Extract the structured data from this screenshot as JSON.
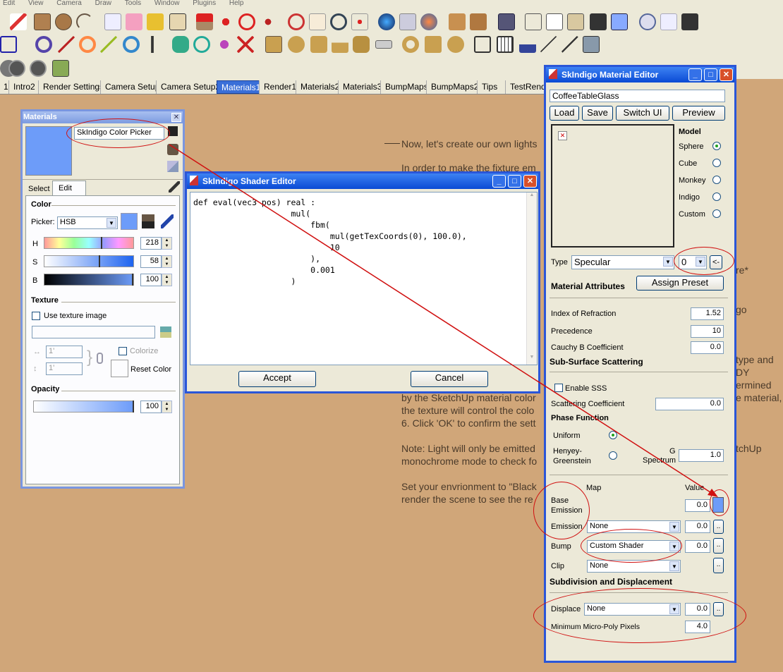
{
  "menubar": [
    "Edit",
    "View",
    "Camera",
    "Draw",
    "Tools",
    "Window",
    "Plugins",
    "Help"
  ],
  "tabs": [
    {
      "label": "1"
    },
    {
      "label": "Intro2"
    },
    {
      "label": "Render Settings"
    },
    {
      "label": "Camera Setup"
    },
    {
      "label": "Camera Setup2"
    },
    {
      "label": "Materials1",
      "active": true
    },
    {
      "label": "Render1"
    },
    {
      "label": "Materials2"
    },
    {
      "label": "Materials3"
    },
    {
      "label": "BumpMaps"
    },
    {
      "label": "BumpMaps2"
    },
    {
      "label": "Tips"
    },
    {
      "label": "TestRend"
    }
  ],
  "background_text": {
    "line1": "Now, let's create our own lights",
    "line2": "In order to make the fixture em",
    "line3": "re*",
    "line4": "go",
    "line5": "type and",
    "line6": "DY",
    "line7": "ermined",
    "line8": "by the SketchUp material color",
    "line9": "e material,",
    "line10": "the texture will control the colo",
    "line11": "6. Click 'OK' to confirm the sett",
    "line12": "Note: Light will only be emitted",
    "line13": "tchUp",
    "line14": "monochrome mode to check fo",
    "line15": "Set your envrionment to \"Black",
    "line16": "render the scene to see the re"
  },
  "materials": {
    "title": "Materials",
    "name_value": "SkIndigo Color Picker",
    "tab_select": "Select",
    "tab_edit": "Edit",
    "color_heading": "Color",
    "picker_label": "Picker:",
    "picker_value": "HSB",
    "h_label": "H",
    "h_value": "218",
    "s_label": "S",
    "s_value": "58",
    "b_label": "B",
    "b_value": "100",
    "texture_heading": "Texture",
    "use_texture": "Use texture image",
    "width_value": "1'",
    "height_value": "1'",
    "colorize": "Colorize",
    "reset_color": "Reset Color",
    "opacity_heading": "Opacity",
    "opacity_value": "100",
    "swatch_color": "#6d9cf9"
  },
  "shader": {
    "title": "SkIndigo Shader Editor",
    "code": [
      "def eval(vec3 pos) real :",
      "                    mul(",
      "                        fbm(",
      "                            mul(getTexCoords(0), 100.0),",
      "                            10",
      "                        ),",
      "                        0.001",
      "                    )"
    ],
    "accept": "Accept",
    "cancel": "Cancel"
  },
  "matedit": {
    "title": "SkIndigo Material Editor",
    "name_value": "CoffeeTableGlass",
    "load": "Load",
    "save": "Save",
    "switch_ui": "Switch UI",
    "preview": "Preview",
    "model_heading": "Model",
    "models": [
      {
        "label": "Sphere",
        "on": true
      },
      {
        "label": "Cube"
      },
      {
        "label": "Monkey"
      },
      {
        "label": "Indigo"
      },
      {
        "label": "Custom"
      }
    ],
    "type_label": "Type",
    "type_value": "Specular",
    "index_value": "0",
    "back_btn": "<-",
    "attrs_heading": "Material Attributes",
    "assign_preset": "Assign Preset",
    "ior_label": "Index of Refraction",
    "ior_value": "1.52",
    "prec_label": "Precedence",
    "prec_value": "10",
    "cauchy_label": "Cauchy B Coefficient",
    "cauchy_value": "0.0",
    "sss_heading": "Sub-Surface Scattering",
    "enable_sss": "Enable SSS",
    "scat_label": "Scattering Coefficient",
    "scat_value": "0.0",
    "phase_heading": "Phase Function",
    "uniform": "Uniform",
    "henyey": "Henyey-\nGreenstein",
    "g_label": "G",
    "spectrum_label": "Spectrum",
    "g_value": "1.0",
    "map_label": "Map",
    "value_label": "Value",
    "base_emission": "Base\nEmission",
    "base_emission_value": "0.0",
    "emission_label": "Emission",
    "emission_map": "None",
    "emission_value": "0.0",
    "bump_label": "Bump",
    "bump_map": "Custom Shader",
    "bump_value": "0.0",
    "clip_label": "Clip",
    "clip_map": "None",
    "subdiv_heading": "Subdivision and Displacement",
    "displace_label": "Displace",
    "displace_map": "None",
    "displace_value": "0.0",
    "micropoly_label": "Minimum Micro-Poly Pixels",
    "micropoly_value": "4.0",
    "dots": "..",
    "swatch_color": "#6d9cf9"
  },
  "colors": {
    "annotation": "#d01010",
    "titlebar": "#0a4ad4",
    "background": "#d0a679"
  }
}
